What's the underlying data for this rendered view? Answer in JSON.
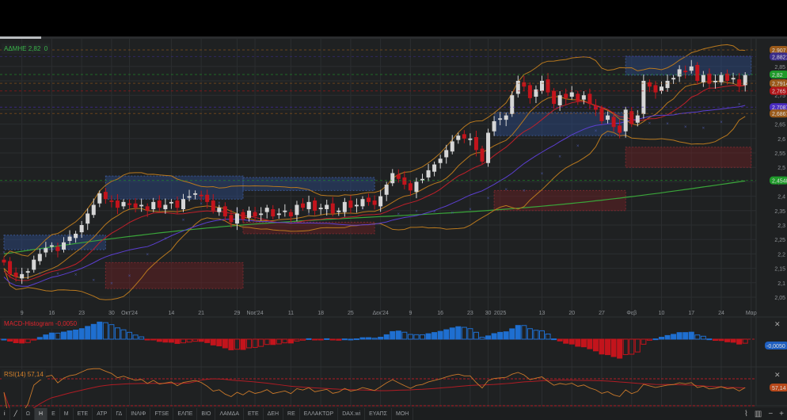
{
  "symbol_legend": {
    "symbol": "ΑΔΜΗΕ",
    "last": "2,82",
    "change": "0"
  },
  "macd_legend": "MACD-Histogram -0,0050",
  "rsi_legend": "RSI(14) 57,14",
  "colors": {
    "background": "#1f2122",
    "grid": "#2b2e30",
    "up": "#d6d6d6",
    "down": "#c3141c",
    "bb": "#b8781e",
    "ma_fast": "#c0202a",
    "ma_slow": "#5b3fd0",
    "ma_long": "#3aa53a",
    "macd_pos": "#1f6fd0",
    "macd_neg": "#c3141c",
    "rsi": "#c8782a",
    "rsi_ma": "#b01c24"
  },
  "price_axis": {
    "min": 2.03,
    "max": 2.93,
    "ticks": [
      "2,05",
      "2,1",
      "2,15",
      "2,2",
      "2,25",
      "2,3",
      "2,35",
      "2,4",
      "2,45",
      "2,5",
      "2,55",
      "2,6",
      "2,65",
      "2,7",
      "2,75",
      "2,8",
      "2,85"
    ]
  },
  "price_badges": [
    {
      "label": "2,907",
      "value": 2.907,
      "color": "#9a5a1a"
    },
    {
      "label": "2,8821",
      "value": 2.884,
      "color": "#3a2c8a"
    },
    {
      "label": "2,82",
      "value": 2.822,
      "color": "#1f9a2a"
    },
    {
      "label": "2,7914",
      "value": 2.7914,
      "color": "#9a5a1a"
    },
    {
      "label": "2,765",
      "value": 2.765,
      "color": "#b01418"
    },
    {
      "label": "2,7087",
      "value": 2.7087,
      "color": "#4a2cc0"
    },
    {
      "label": "2,6867",
      "value": 2.6867,
      "color": "#9a5a1a"
    },
    {
      "label": "2,4548",
      "value": 2.4548,
      "color": "#1f9a2a"
    }
  ],
  "macd_badge": "-0,0050",
  "rsi_badge": "57,14",
  "date_ticks": [
    {
      "label": "9",
      "i": 3
    },
    {
      "label": "16",
      "i": 8
    },
    {
      "label": "23",
      "i": 13
    },
    {
      "label": "30",
      "i": 18
    },
    {
      "label": "Οκτ'24",
      "i": 21
    },
    {
      "label": "14",
      "i": 28
    },
    {
      "label": "21",
      "i": 33
    },
    {
      "label": "29",
      "i": 39
    },
    {
      "label": "Νοε'24",
      "i": 42
    },
    {
      "label": "11",
      "i": 48
    },
    {
      "label": "18",
      "i": 53
    },
    {
      "label": "25",
      "i": 58
    },
    {
      "label": "Δεκ'24",
      "i": 63
    },
    {
      "label": "9",
      "i": 68
    },
    {
      "label": "16",
      "i": 73
    },
    {
      "label": "23",
      "i": 78
    },
    {
      "label": "30",
      "i": 81
    },
    {
      "label": "2025",
      "i": 83
    },
    {
      "label": "13",
      "i": 90
    },
    {
      "label": "20",
      "i": 95
    },
    {
      "label": "27",
      "i": 100
    },
    {
      "label": "Φεβ",
      "i": 105
    },
    {
      "label": "10",
      "i": 110
    },
    {
      "label": "17",
      "i": 115
    },
    {
      "label": "24",
      "i": 120
    },
    {
      "label": "Μαρ",
      "i": 125
    }
  ],
  "closes": [
    2.17,
    2.13,
    2.12,
    2.13,
    2.14,
    2.18,
    2.2,
    2.22,
    2.23,
    2.21,
    2.24,
    2.26,
    2.27,
    2.3,
    2.34,
    2.37,
    2.41,
    2.39,
    2.38,
    2.36,
    2.38,
    2.37,
    2.36,
    2.37,
    2.35,
    2.38,
    2.36,
    2.37,
    2.38,
    2.36,
    2.39,
    2.4,
    2.41,
    2.4,
    2.38,
    2.35,
    2.36,
    2.33,
    2.31,
    2.34,
    2.32,
    2.35,
    2.33,
    2.34,
    2.36,
    2.33,
    2.34,
    2.35,
    2.33,
    2.37,
    2.36,
    2.38,
    2.35,
    2.36,
    2.37,
    2.34,
    2.35,
    2.38,
    2.36,
    2.37,
    2.39,
    2.38,
    2.37,
    2.4,
    2.44,
    2.48,
    2.46,
    2.44,
    2.42,
    2.45,
    2.46,
    2.49,
    2.51,
    2.53,
    2.56,
    2.59,
    2.61,
    2.6,
    2.6,
    2.56,
    2.52,
    2.62,
    2.66,
    2.67,
    2.68,
    2.75,
    2.8,
    2.78,
    2.74,
    2.77,
    2.8,
    2.76,
    2.72,
    2.75,
    2.74,
    2.76,
    2.73,
    2.75,
    2.72,
    2.7,
    2.66,
    2.68,
    2.64,
    2.62,
    2.7,
    2.65,
    2.68,
    2.8,
    2.78,
    2.76,
    2.78,
    2.8,
    2.81,
    2.84,
    2.83,
    2.85,
    2.8,
    2.82,
    2.79,
    2.8,
    2.82,
    2.8,
    2.81,
    2.78,
    2.82
  ],
  "long_ma": [
    2.2,
    2.4548
  ],
  "zones": [
    {
      "type": "supply",
      "from": 0,
      "to": 17,
      "low": 2.215,
      "high": 2.265
    },
    {
      "type": "demand",
      "from": 17,
      "to": 40,
      "low": 2.08,
      "high": 2.17
    },
    {
      "type": "supply",
      "from": 17,
      "to": 40,
      "low": 2.39,
      "high": 2.47
    },
    {
      "type": "supply",
      "from": 40,
      "to": 62,
      "low": 2.42,
      "high": 2.465
    },
    {
      "type": "demand",
      "from": 40,
      "to": 62,
      "low": 2.27,
      "high": 2.31
    },
    {
      "type": "demand",
      "from": 82,
      "to": 104,
      "low": 2.35,
      "high": 2.42
    },
    {
      "type": "supply",
      "from": 82,
      "to": 104,
      "low": 2.61,
      "high": 2.69
    },
    {
      "type": "supply",
      "from": 104,
      "to": 125,
      "low": 2.82,
      "high": 2.885
    },
    {
      "type": "demand",
      "from": 104,
      "to": 125,
      "low": 2.5,
      "high": 2.57
    }
  ],
  "toolbar": [
    "Ω",
    "Η",
    "Ε",
    "Μ",
    "ΕΤΕ",
    "ΑΤΡ",
    "ΓΔ",
    "ΙΝΛΙΦ",
    "FTSE",
    "ΕΛΠΕ",
    "ΒΙΟ",
    "ΛΑΜΔΑ",
    "ΕΤΕ",
    "ΔΕΗ",
    "RE",
    "ΕΛΛΑΚΤΩΡ",
    "DAX.wi",
    "ΕΥΑΠΣ",
    "ΜΟΗ"
  ],
  "toolbar_active": "Η",
  "zoom_controls": {
    "line_chart": "⌇",
    "bar_chart": "▥",
    "zoom_out": "−",
    "zoom_in": "+"
  }
}
